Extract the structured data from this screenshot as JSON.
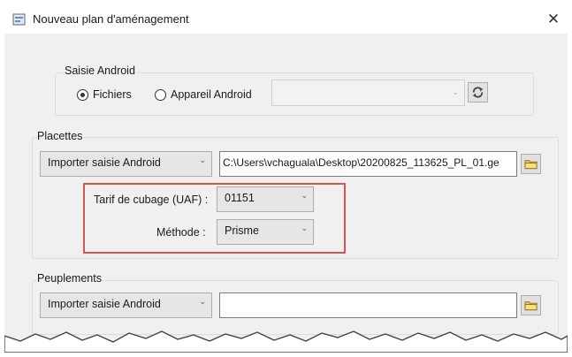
{
  "dialog": {
    "title": "Nouveau plan d'aménagement",
    "close_glyph": "✕"
  },
  "saisie_android": {
    "legend": "Saisie Android",
    "radio_fichiers": {
      "label": "Fichiers",
      "checked": true
    },
    "radio_appareil": {
      "label": "Appareil Android",
      "checked": false
    },
    "device_select": {
      "value": "",
      "disabled": true
    }
  },
  "placettes": {
    "legend": "Placettes",
    "import_dropdown": "Importer saisie Android",
    "file_path": "C:\\Users\\vchaguala\\Desktop\\20200825_113625_PL_01.ge",
    "tarif_label": "Tarif de cubage (UAF) :",
    "tarif_value": "01151",
    "methode_label": "Méthode :",
    "methode_value": "Prisme"
  },
  "peuplements": {
    "legend": "Peuplements",
    "import_dropdown": "Importer saisie Android",
    "file_path": ""
  },
  "colors": {
    "highlight": "#d9534f",
    "folder": "#f3d15e"
  }
}
